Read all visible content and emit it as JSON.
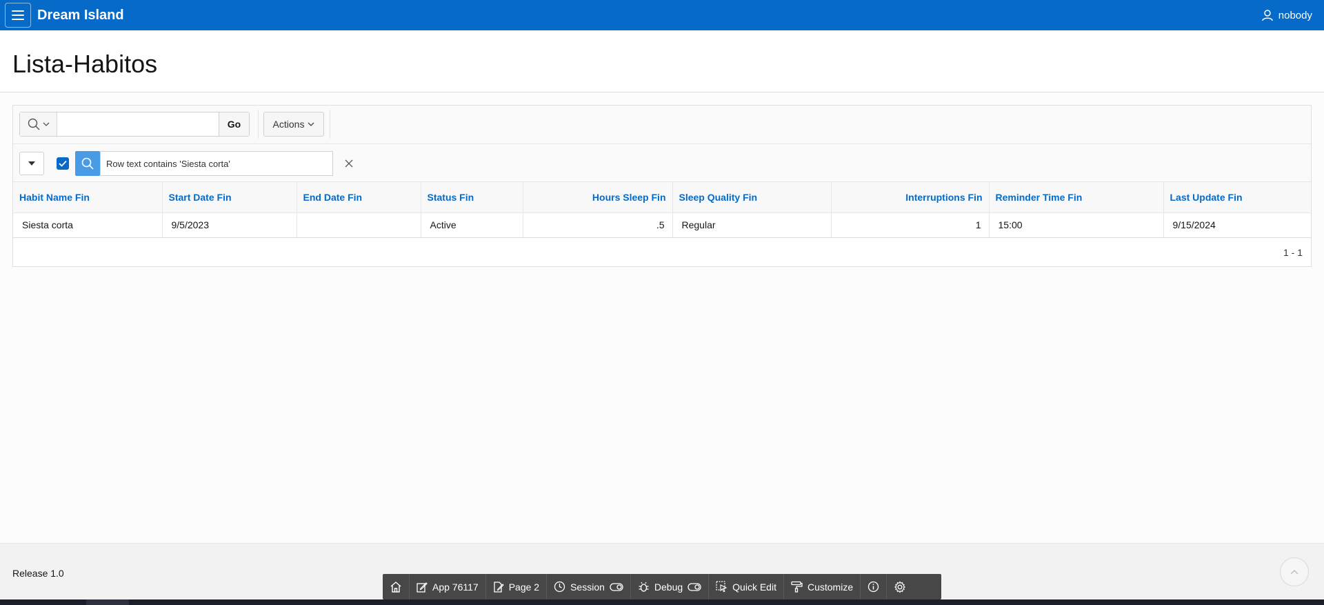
{
  "header": {
    "app_title": "Dream Island",
    "user_name": "nobody"
  },
  "page": {
    "title": "Lista-Habitos"
  },
  "toolbar": {
    "search_placeholder": "",
    "search_value": "",
    "go_label": "Go",
    "actions_label": "Actions"
  },
  "filter": {
    "text": "Row text contains 'Siesta corta'"
  },
  "table": {
    "columns": [
      {
        "label": "Habit Name Fin"
      },
      {
        "label": "Start Date Fin"
      },
      {
        "label": "End Date Fin"
      },
      {
        "label": "Status Fin"
      },
      {
        "label": "Hours Sleep Fin"
      },
      {
        "label": "Sleep Quality Fin"
      },
      {
        "label": "Interruptions Fin"
      },
      {
        "label": "Reminder Time Fin"
      },
      {
        "label": "Last Update Fin"
      }
    ],
    "rows": [
      [
        "Siesta corta",
        "9/5/2023",
        "",
        "Active",
        ".5",
        "Regular",
        "1",
        "15:00",
        "9/15/2024"
      ]
    ]
  },
  "pagination": {
    "text": "1 - 1"
  },
  "footer": {
    "release": "Release 1.0"
  },
  "devbar": {
    "items": [
      {
        "label": ""
      },
      {
        "label": "App 76117"
      },
      {
        "label": "Page 2"
      },
      {
        "label": "Session"
      },
      {
        "label": "Debug"
      },
      {
        "label": "Quick Edit"
      },
      {
        "label": "Customize"
      },
      {
        "label": ""
      },
      {
        "label": ""
      }
    ]
  },
  "colors": {
    "header_bg": "#056ac8",
    "link_blue": "#056ac8",
    "filter_icon_bg": "#4a9be6",
    "devbar_bg": "#474747"
  },
  "icons": {
    "menu": "hamburger-icon",
    "user": "user-icon",
    "search": "search-icon",
    "chevron": "chevron-down-icon",
    "close": "close-icon"
  }
}
